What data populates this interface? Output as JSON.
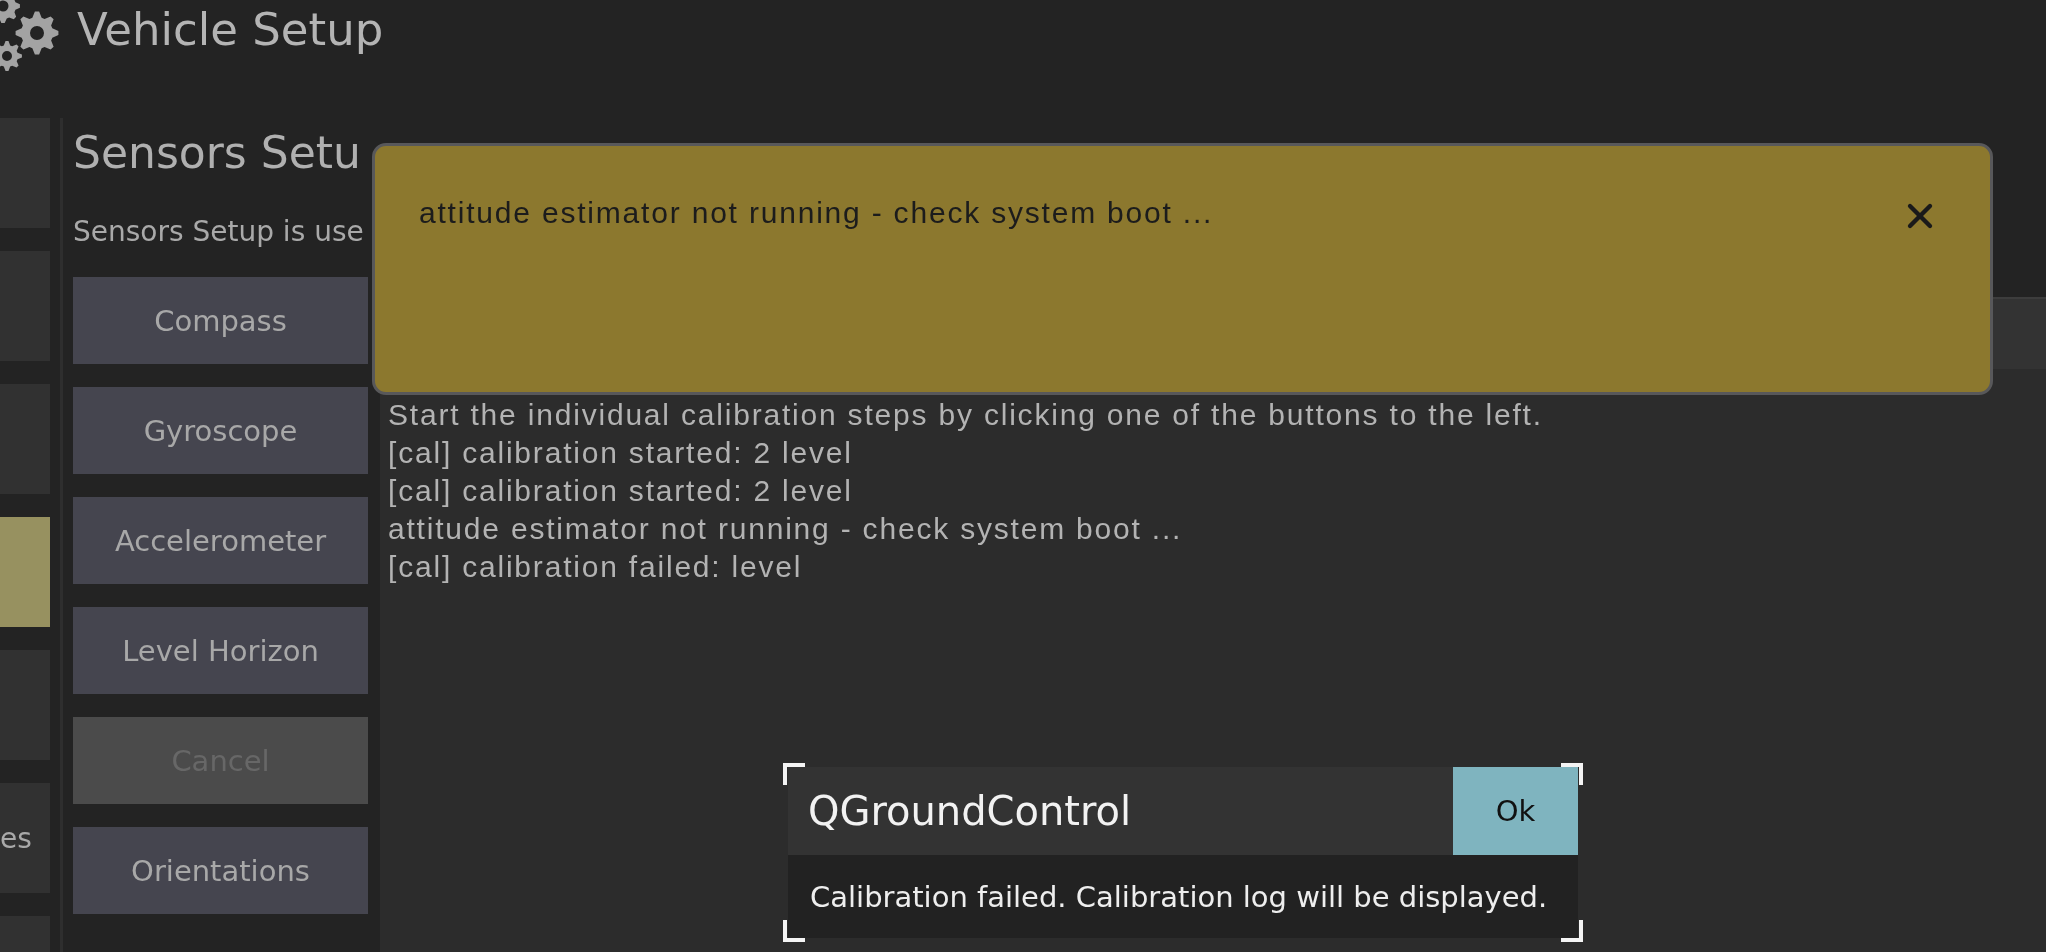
{
  "header": {
    "title": "Vehicle Setup"
  },
  "sidebar": {
    "items": [
      {
        "selected": false
      },
      {
        "selected": false
      },
      {
        "selected": false
      },
      {
        "selected": true
      },
      {
        "selected": false
      },
      {
        "label": "es",
        "selected": false
      },
      {
        "selected": false
      }
    ]
  },
  "sensors_setup": {
    "title": "Sensors Setu",
    "description": "Sensors Setup is use"
  },
  "calibration_buttons": [
    {
      "label": "Compass",
      "disabled": false
    },
    {
      "label": "Gyroscope",
      "disabled": false
    },
    {
      "label": "Accelerometer",
      "disabled": false
    },
    {
      "label": "Level Horizon",
      "disabled": false
    },
    {
      "label": "Cancel",
      "disabled": true
    },
    {
      "label": "Orientations",
      "disabled": false
    }
  ],
  "log": {
    "lines": [
      "Start the individual calibration steps by clicking one of the buttons to the left.",
      "[cal] calibration started: 2 level",
      "[cal] calibration started: 2 level",
      "attitude estimator not running - check system boot ...",
      "[cal] calibration failed: level"
    ]
  },
  "notification": {
    "message": "attitude estimator not running - check system boot ..."
  },
  "dialog": {
    "title": "QGroundControl",
    "button": "Ok",
    "message": "Calibration failed. Calibration log will be displayed."
  }
}
